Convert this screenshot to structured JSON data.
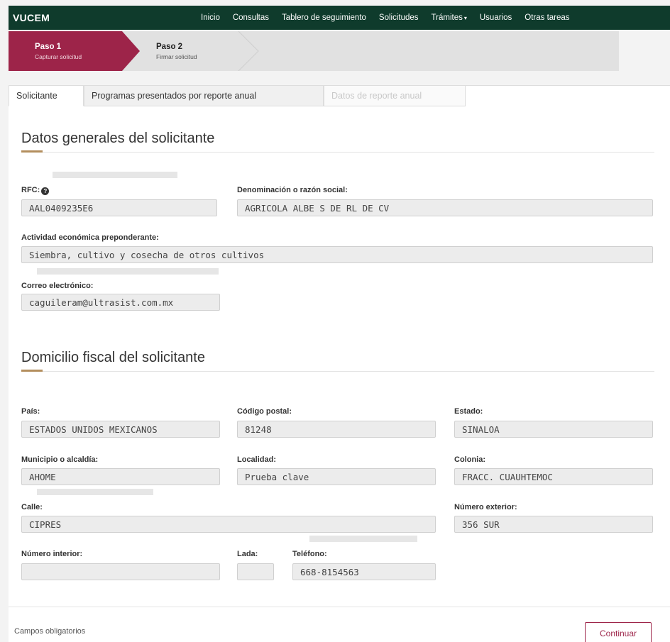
{
  "navbar": {
    "brand": "VUCEM",
    "items": [
      "Inicio",
      "Consultas",
      "Tablero de seguimiento",
      "Solicitudes",
      "Trámites",
      "Usuarios",
      "Otras tareas"
    ]
  },
  "wizard": {
    "step1": {
      "title": "Paso 1",
      "subtitle": "Capturar solicitud"
    },
    "step2": {
      "title": "Paso 2",
      "subtitle": "Firmar solicitud"
    }
  },
  "tabs": [
    "Solicitante",
    "Programas presentados por reporte anual",
    "Datos de reporte anual"
  ],
  "general": {
    "title": "Datos generales del solicitante",
    "rfc_label": "RFC:",
    "rfc_value": "AAL0409235E6",
    "razon_label": "Denominación o razón social:",
    "razon_value": "AGRICOLA ALBE S DE RL DE CV",
    "actividad_label": "Actividad económica preponderante:",
    "actividad_value": "Siembra, cultivo y cosecha de otros cultivos",
    "correo_label": "Correo electrónico:",
    "correo_value": "caguileram@ultrasist.com.mx"
  },
  "domicilio": {
    "title": "Domicilio fiscal del solicitante",
    "pais_label": "País:",
    "pais_value": "ESTADOS UNIDOS MEXICANOS",
    "cp_label": "Código postal:",
    "cp_value": "81248",
    "estado_label": "Estado:",
    "estado_value": "SINALOA",
    "municipio_label": "Municipio o alcaldía:",
    "municipio_value": "AHOME",
    "localidad_label": "Localidad:",
    "localidad_value": "Prueba clave",
    "colonia_label": "Colonia:",
    "colonia_value": "FRACC. CUAUHTEMOC",
    "calle_label": "Calle:",
    "calle_value": "CIPRES",
    "num_ext_label": "Número exterior:",
    "num_ext_value": "356 SUR",
    "num_int_label": "Número interior:",
    "num_int_value": "",
    "lada_label": "Lada:",
    "lada_value": "",
    "telefono_label": "Teléfono:",
    "telefono_value": "668-8154563"
  },
  "footer": {
    "note": "Campos obligatorios",
    "continue_label": "Continuar"
  },
  "colors": {
    "navbar": "#0f3b2c",
    "accent": "#9d2449",
    "gold": "#b38e5d"
  }
}
